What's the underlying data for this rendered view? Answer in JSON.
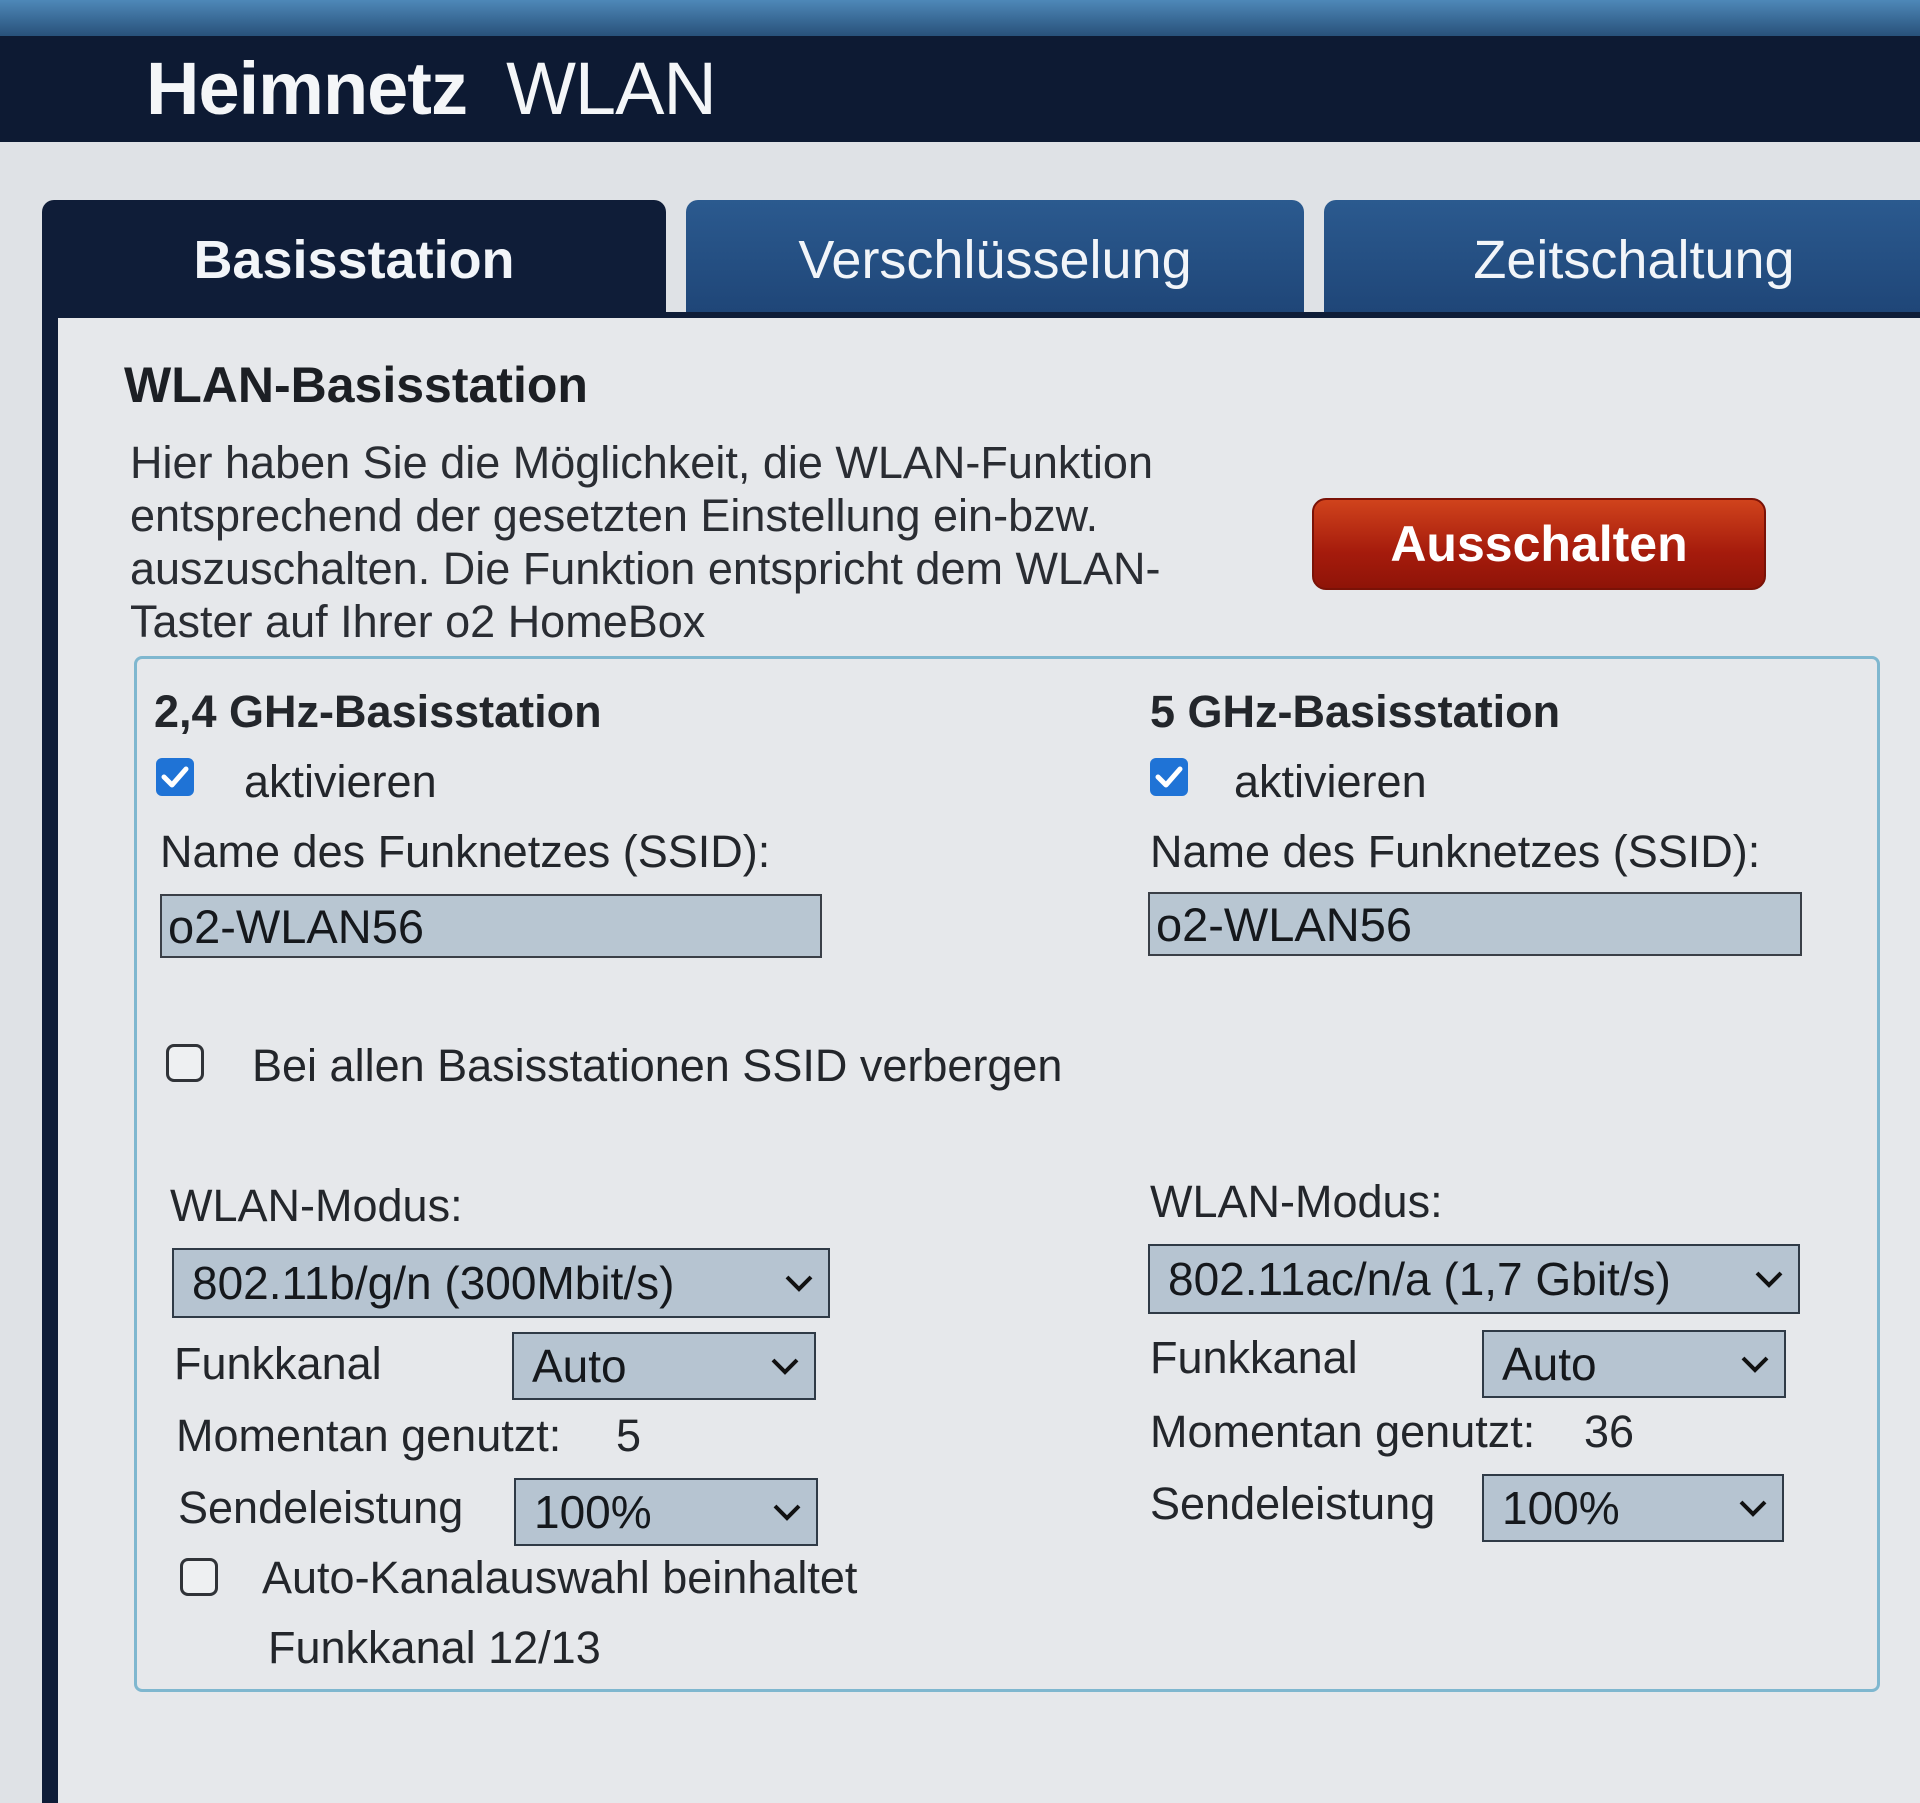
{
  "header": {
    "title_bold": "Heimnetz",
    "title_rest": "WLAN"
  },
  "tabs": [
    {
      "label": "Basisstation",
      "active": true
    },
    {
      "label": "Verschlüsselung",
      "active": false
    },
    {
      "label": "Zeitschaltung",
      "active": false
    }
  ],
  "section": {
    "title": "WLAN-Basisstation",
    "description_lines": [
      "Hier haben Sie die Möglichkeit, die WLAN-Funktion",
      "entsprechend der gesetzten Einstellung ein-bzw.",
      "auszuschalten. Die Funktion entspricht dem WLAN-",
      "Taster auf Ihrer o2 HomeBox"
    ],
    "toggle_button_label": "Ausschalten"
  },
  "band24": {
    "title": "2,4 GHz-Basisstation",
    "activate_label": "aktivieren",
    "activate_checked": true,
    "ssid_label": "Name des Funknetzes (SSID):",
    "ssid_value": "o2-WLAN56",
    "mode_label": "WLAN-Modus:",
    "mode_value": "802.11b/g/n (300Mbit/s)",
    "channel_label": "Funkkanal",
    "channel_value": "Auto",
    "current_label": "Momentan genutzt:",
    "current_value": "5",
    "power_label": "Sendeleistung",
    "power_value": "100%",
    "auto_channel_label": "Auto-Kanalauswahl beinhaltet",
    "auto_channel_label2": "Funkkanal 12/13",
    "auto_channel_checked": false
  },
  "band5": {
    "title": "5 GHz-Basisstation",
    "activate_label": "aktivieren",
    "activate_checked": true,
    "ssid_label": "Name des Funknetzes (SSID):",
    "ssid_value": "o2-WLAN56",
    "mode_label": "WLAN-Modus:",
    "mode_value": "802.11ac/n/a (1,7 Gbit/s)",
    "channel_label": "Funkkanal",
    "channel_value": "Auto",
    "current_label": "Momentan genutzt:",
    "current_value": "36",
    "power_label": "Sendeleistung",
    "power_value": "100%"
  },
  "hide_ssid": {
    "label": "Bei allen Basisstationen SSID verbergen",
    "checked": false
  },
  "colors": {
    "header": "#0d1a33",
    "tab_active": "#0f1d38",
    "tab_inactive": "#1f4678",
    "button_red": "#a51b0c",
    "checkbox_blue": "#1f73d6",
    "frame": "#7fb7cf"
  }
}
